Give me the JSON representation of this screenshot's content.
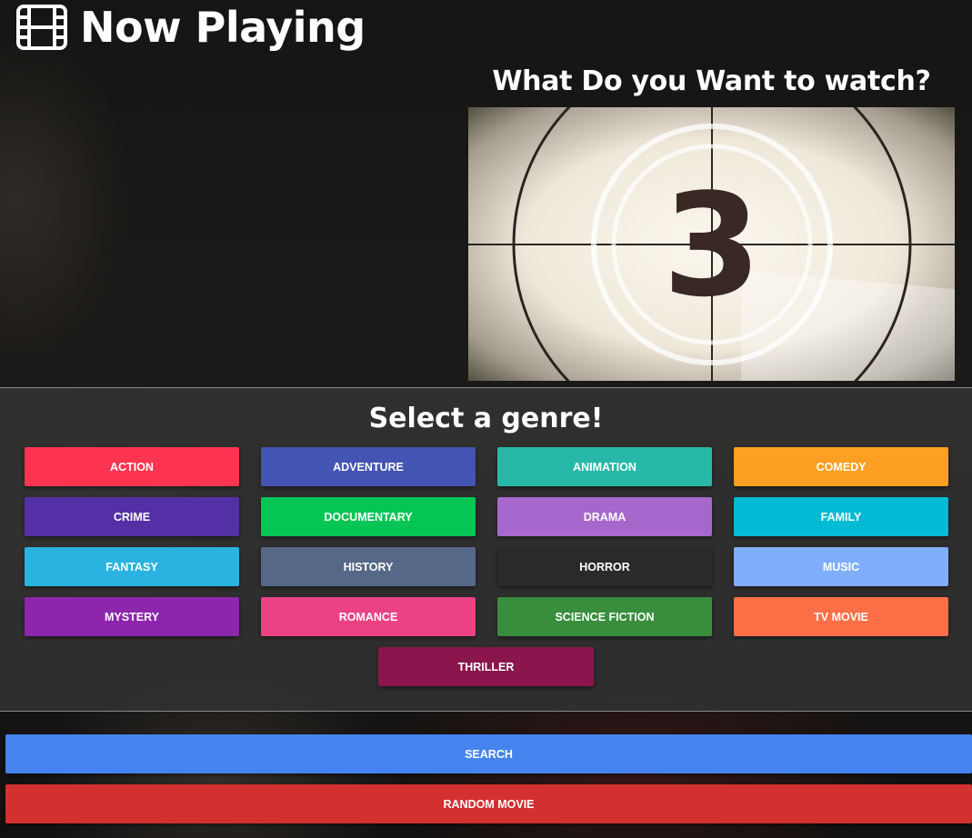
{
  "header": {
    "title": "Now Playing",
    "icon": "film-icon"
  },
  "main": {
    "prompt": "What Do you Want to watch?",
    "countdown_number": "3"
  },
  "genres": {
    "title": "Select a genre!",
    "items": [
      {
        "label": "ACTION",
        "color": "#fe3550"
      },
      {
        "label": "ADVENTURE",
        "color": "#4454b3"
      },
      {
        "label": "ANIMATION",
        "color": "#28b8a7"
      },
      {
        "label": "COMEDY",
        "color": "#fd9f22"
      },
      {
        "label": "CRIME",
        "color": "#5430a6"
      },
      {
        "label": "DOCUMENTARY",
        "color": "#05c654"
      },
      {
        "label": "DRAMA",
        "color": "#a768cd"
      },
      {
        "label": "FAMILY",
        "color": "#01bad4"
      },
      {
        "label": "FANTASY",
        "color": "#2ab3e0"
      },
      {
        "label": "HISTORY",
        "color": "#566888"
      },
      {
        "label": "HORROR",
        "color": "#2a2a2a"
      },
      {
        "label": "MUSIC",
        "color": "#80aefd"
      },
      {
        "label": "MYSTERY",
        "color": "#8d26ac"
      },
      {
        "label": "ROMANCE",
        "color": "#ea4282"
      },
      {
        "label": "SCIENCE FICTION",
        "color": "#388e3c"
      },
      {
        "label": "TV MOVIE",
        "color": "#fe6f47"
      }
    ],
    "last": {
      "label": "THRILLER",
      "color": "#8b154d"
    }
  },
  "actions": {
    "search": {
      "label": "SEARCH",
      "color": "#4584ef"
    },
    "random": {
      "label": "RANDOM MOVIE",
      "color": "#d33030"
    }
  }
}
